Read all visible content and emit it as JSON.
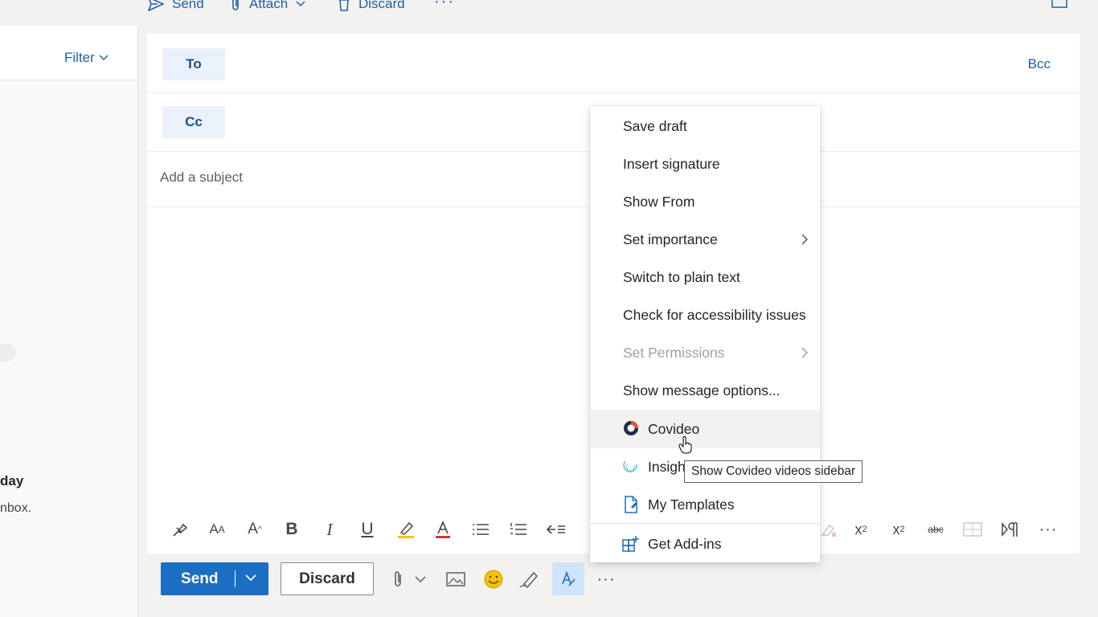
{
  "topbar": {
    "send_label": "Send",
    "attach_label": "Attach",
    "discard_label": "Discard",
    "more_label": "···"
  },
  "listpane": {
    "filter_label": "Filter",
    "day_text": "day",
    "inbox_text": "nbox."
  },
  "compose": {
    "to_label": "To",
    "cc_label": "Cc",
    "bcc_label": "Bcc",
    "subject_placeholder": "Add a subject"
  },
  "actions": {
    "send_label": "Send",
    "discard_label": "Discard",
    "more_label": "···"
  },
  "menu": {
    "items": [
      {
        "label": "Save draft"
      },
      {
        "label": "Insert signature"
      },
      {
        "label": "Show From"
      },
      {
        "label": "Set importance"
      },
      {
        "label": "Switch to plain text"
      },
      {
        "label": "Check for accessibility issues"
      },
      {
        "label": "Set Permissions"
      },
      {
        "label": "Show message options..."
      },
      {
        "label": "Covideo"
      },
      {
        "label": "Insigh"
      },
      {
        "label": "My Templates"
      },
      {
        "label": "Get Add-ins"
      }
    ]
  },
  "tooltip": {
    "text": "Show Covideo videos sidebar"
  },
  "colors": {
    "accent": "#1b6ec2",
    "link": "#1f5fa8",
    "pill_bg": "#eaf1fb",
    "highlight": "#f3c300",
    "font_color_red": "#d13438"
  }
}
